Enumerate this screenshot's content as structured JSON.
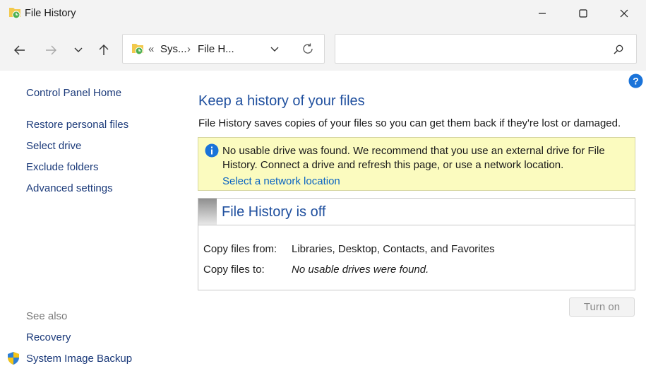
{
  "window": {
    "title": "File History"
  },
  "address": {
    "overflow": "«",
    "crumb1": "Sys...",
    "sep": "›",
    "crumb2": "File H..."
  },
  "search": {
    "placeholder": ""
  },
  "sidebar": {
    "home": "Control Panel Home",
    "links": [
      "Restore personal files",
      "Select drive",
      "Exclude folders",
      "Advanced settings"
    ],
    "see_also": "See also",
    "see_also_links": [
      "Recovery",
      "System Image Backup"
    ]
  },
  "main": {
    "heading": "Keep a history of your files",
    "description": "File History saves copies of your files so you can get them back if they're lost or damaged.",
    "warning": {
      "message": "No usable drive was found. We recommend that you use an external drive for File History. Connect a drive and refresh this page, or use a network location.",
      "link": "Select a network location"
    },
    "status": {
      "title": "File History is off",
      "copy_from_label": "Copy files from:",
      "copy_from_value": "Libraries, Desktop, Contacts, and Favorites",
      "copy_to_label": "Copy files to:",
      "copy_to_value": "No usable drives were found."
    },
    "turn_on_label": "Turn on"
  },
  "colors": {
    "link": "#1b3a7a",
    "heading": "#1f4f9e",
    "warning_bg": "#fbfbbf",
    "info": "#1a73d9"
  },
  "icons": [
    "file-history-icon",
    "minimize-icon",
    "maximize-icon",
    "close-icon",
    "back-arrow-icon",
    "forward-arrow-icon",
    "recent-locations-chevron-icon",
    "up-arrow-icon",
    "refresh-icon",
    "address-dropdown-icon",
    "search-icon",
    "help-icon",
    "info-icon",
    "shield-icon"
  ]
}
